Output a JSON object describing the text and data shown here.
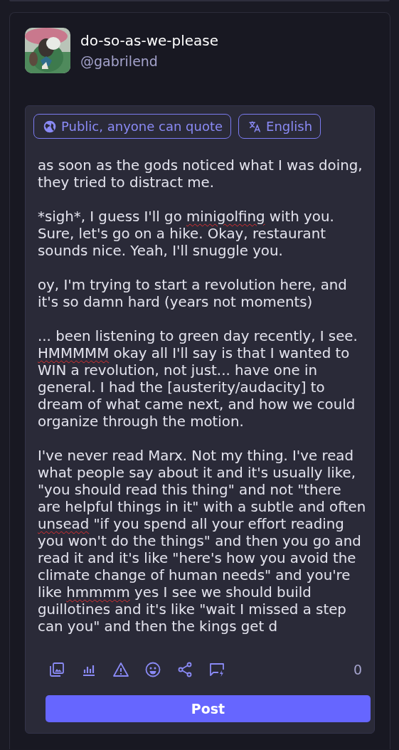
{
  "author": {
    "display_name": "do-so-as-we-please",
    "handle": "@gabrilend"
  },
  "composer": {
    "chips": [
      {
        "kind": "visibility",
        "label": "Public, anyone can quote"
      },
      {
        "kind": "language",
        "label": "English"
      }
    ],
    "paragraphs": [
      [
        {
          "text": "as soon as the gods noticed what I was doing, they tried to distract me.",
          "misspelled": false
        }
      ],
      [
        {
          "text": "*sigh*, I guess I'll go ",
          "misspelled": false
        },
        {
          "text": "minigolfing",
          "misspelled": true
        },
        {
          "text": " with you. Sure, let's go on a hike. Okay, restaurant sounds nice. Yeah, I'll snuggle you.",
          "misspelled": false
        }
      ],
      [
        {
          "text": "oy, I'm trying to start a revolution here, and it's so damn hard (years not moments)",
          "misspelled": false
        }
      ],
      [
        {
          "text": "... been listening to green day recently, I see. ",
          "misspelled": false
        },
        {
          "text": "HMMMMM",
          "misspelled": true
        },
        {
          "text": " okay all I'll say is that I wanted to WIN a revolution, not just... have one in general. I had the [austerity/audacity] to dream of what came next, and how we could organize through the motion.",
          "misspelled": false
        }
      ],
      [
        {
          "text": "I've never read Marx. Not my thing. I've read what people say about it and it's usually like, \"you should read this thing\" and not \"there are helpful things in it\" with a subtle and often ",
          "misspelled": false
        },
        {
          "text": "unsead",
          "misspelled": true
        },
        {
          "text": " \"if you spend all your effort reading you won't do the things\" and then you go and read it and it's like \"here's how you avoid the climate change of human needs\" and you're like ",
          "misspelled": false
        },
        {
          "text": "hmmmm",
          "misspelled": true
        },
        {
          "text": " yes I see we should build guillotines and it's like \"wait I missed a step can you\" and then the kings get d",
          "misspelled": false
        }
      ]
    ],
    "tools": [
      {
        "kind": "media"
      },
      {
        "kind": "poll"
      },
      {
        "kind": "warning"
      },
      {
        "kind": "emoji"
      },
      {
        "kind": "share"
      },
      {
        "kind": "quick-reply"
      }
    ],
    "char_count": "0",
    "post_button": "Post"
  }
}
